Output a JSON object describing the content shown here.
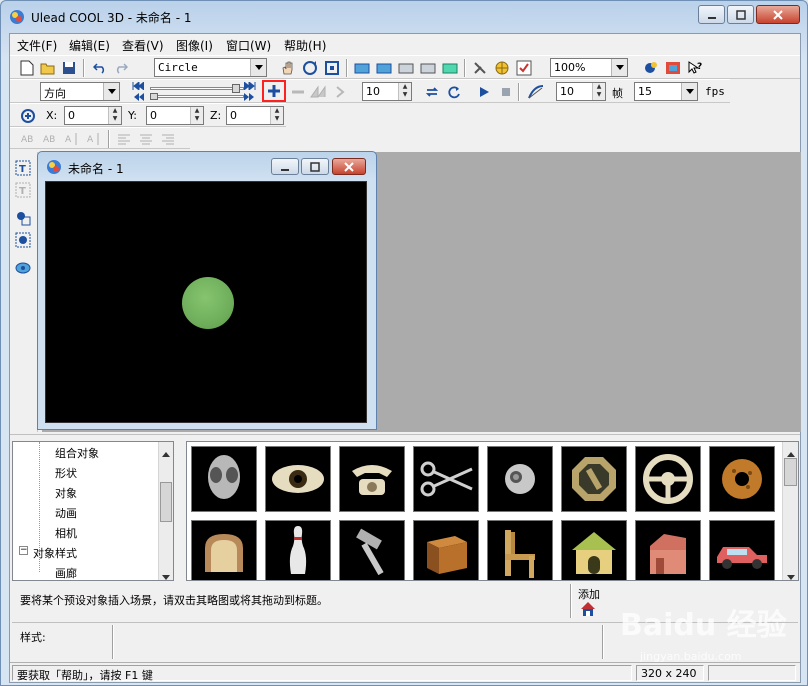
{
  "window": {
    "title": "Ulead COOL 3D - 未命名 - 1"
  },
  "menu": [
    "文件(F)",
    "编辑(E)",
    "查看(V)",
    "图像(I)",
    "窗口(W)",
    "帮助(H)"
  ],
  "toolbar1": {
    "object_combo": "Circle",
    "zoom_combo": "100%"
  },
  "toolbar2": {
    "attribute_combo": "方向",
    "frame_value": "10",
    "speed_value": "10",
    "frame_unit": "帧",
    "fps_value": "15",
    "fps_unit": "fps"
  },
  "toolbar3": {
    "x_label": "X:",
    "x_value": "0",
    "y_label": "Y:",
    "y_value": "0",
    "z_label": "Z:",
    "z_value": "0"
  },
  "document": {
    "title": "未命名 - 1"
  },
  "tree": {
    "items": [
      "组合对象",
      "形状",
      "对象",
      "动画",
      "相机",
      "对象样式",
      "画廊"
    ]
  },
  "thumbnails": [
    "alien-head",
    "eye",
    "telephone",
    "scissors",
    "spiral-shell",
    "octagon-sign",
    "steering-wheel",
    "donut",
    "bread",
    "bowling-pin",
    "hammer",
    "wooden-box",
    "chair",
    "dog-house",
    "barn",
    "car"
  ],
  "hint": {
    "text": "要将某个预设对象插入场景，请双击其略图或将其拖动到标题。",
    "add_label": "添加"
  },
  "style_label": "样式:",
  "statusbar": {
    "help_text": "要获取「帮助」，请按 F1 键",
    "size": "320 x 240"
  },
  "watermark": {
    "brand": "Baidu 经验",
    "url": "jingyan.baidu.com"
  },
  "colors": {
    "canvas": "#000000",
    "ball": "#74b45e",
    "workspace": "#ababab",
    "highlight": "#ff0000"
  }
}
